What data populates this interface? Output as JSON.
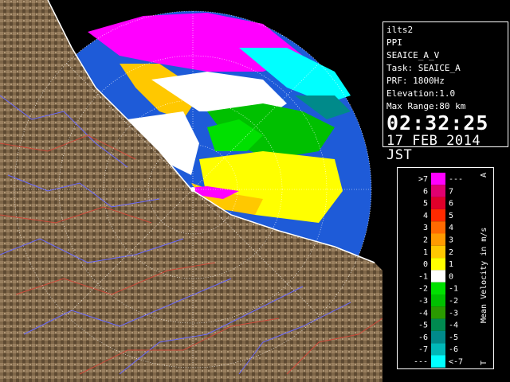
{
  "info": {
    "lines": [
      "ilts2",
      "PPI",
      "SEAICE_A_V",
      "Task: SEAICE_A",
      "PRF: 1800Hz",
      "Elevation:1.0",
      "Max Range:80 km"
    ],
    "time": "02:32:25",
    "date": "17 FEB 2014 JST"
  },
  "legend": {
    "title": "Mean Velocity in m/s",
    "top_marker": "A",
    "bottom_marker": "T",
    "rows": [
      {
        "left": ">7",
        "right": "---",
        "color": "#ff00ff"
      },
      {
        "left": "6",
        "right": "7",
        "color": "#e00070"
      },
      {
        "left": "5",
        "right": "6",
        "color": "#e0002a"
      },
      {
        "left": "4",
        "right": "5",
        "color": "#ff2a00"
      },
      {
        "left": "3",
        "right": "4",
        "color": "#ff6a00"
      },
      {
        "left": "2",
        "right": "3",
        "color": "#ff9a00"
      },
      {
        "left": "1",
        "right": "2",
        "color": "#ffc800"
      },
      {
        "left": "0",
        "right": "1",
        "color": "#ffff00"
      },
      {
        "left": "-1",
        "right": "0",
        "color": "#ffffff"
      },
      {
        "left": "-2",
        "right": "-1",
        "color": "#00e000"
      },
      {
        "left": "-3",
        "right": "-2",
        "color": "#00c000"
      },
      {
        "left": "-4",
        "right": "-3",
        "color": "#2a9a00"
      },
      {
        "left": "-5",
        "right": "-4",
        "color": "#008a50"
      },
      {
        "left": "-6",
        "right": "-5",
        "color": "#008a8a"
      },
      {
        "left": "-7",
        "right": "-6",
        "color": "#00b8b8"
      },
      {
        "left": "---",
        "right": "<-7",
        "color": "#00ffff"
      }
    ]
  },
  "colors": {
    "sky": "#1e5bd8",
    "land": "#8a7050",
    "river": "#6a6aff",
    "road": "#d04a3a",
    "panel_bg": "#000000",
    "text": "#ffffff"
  }
}
